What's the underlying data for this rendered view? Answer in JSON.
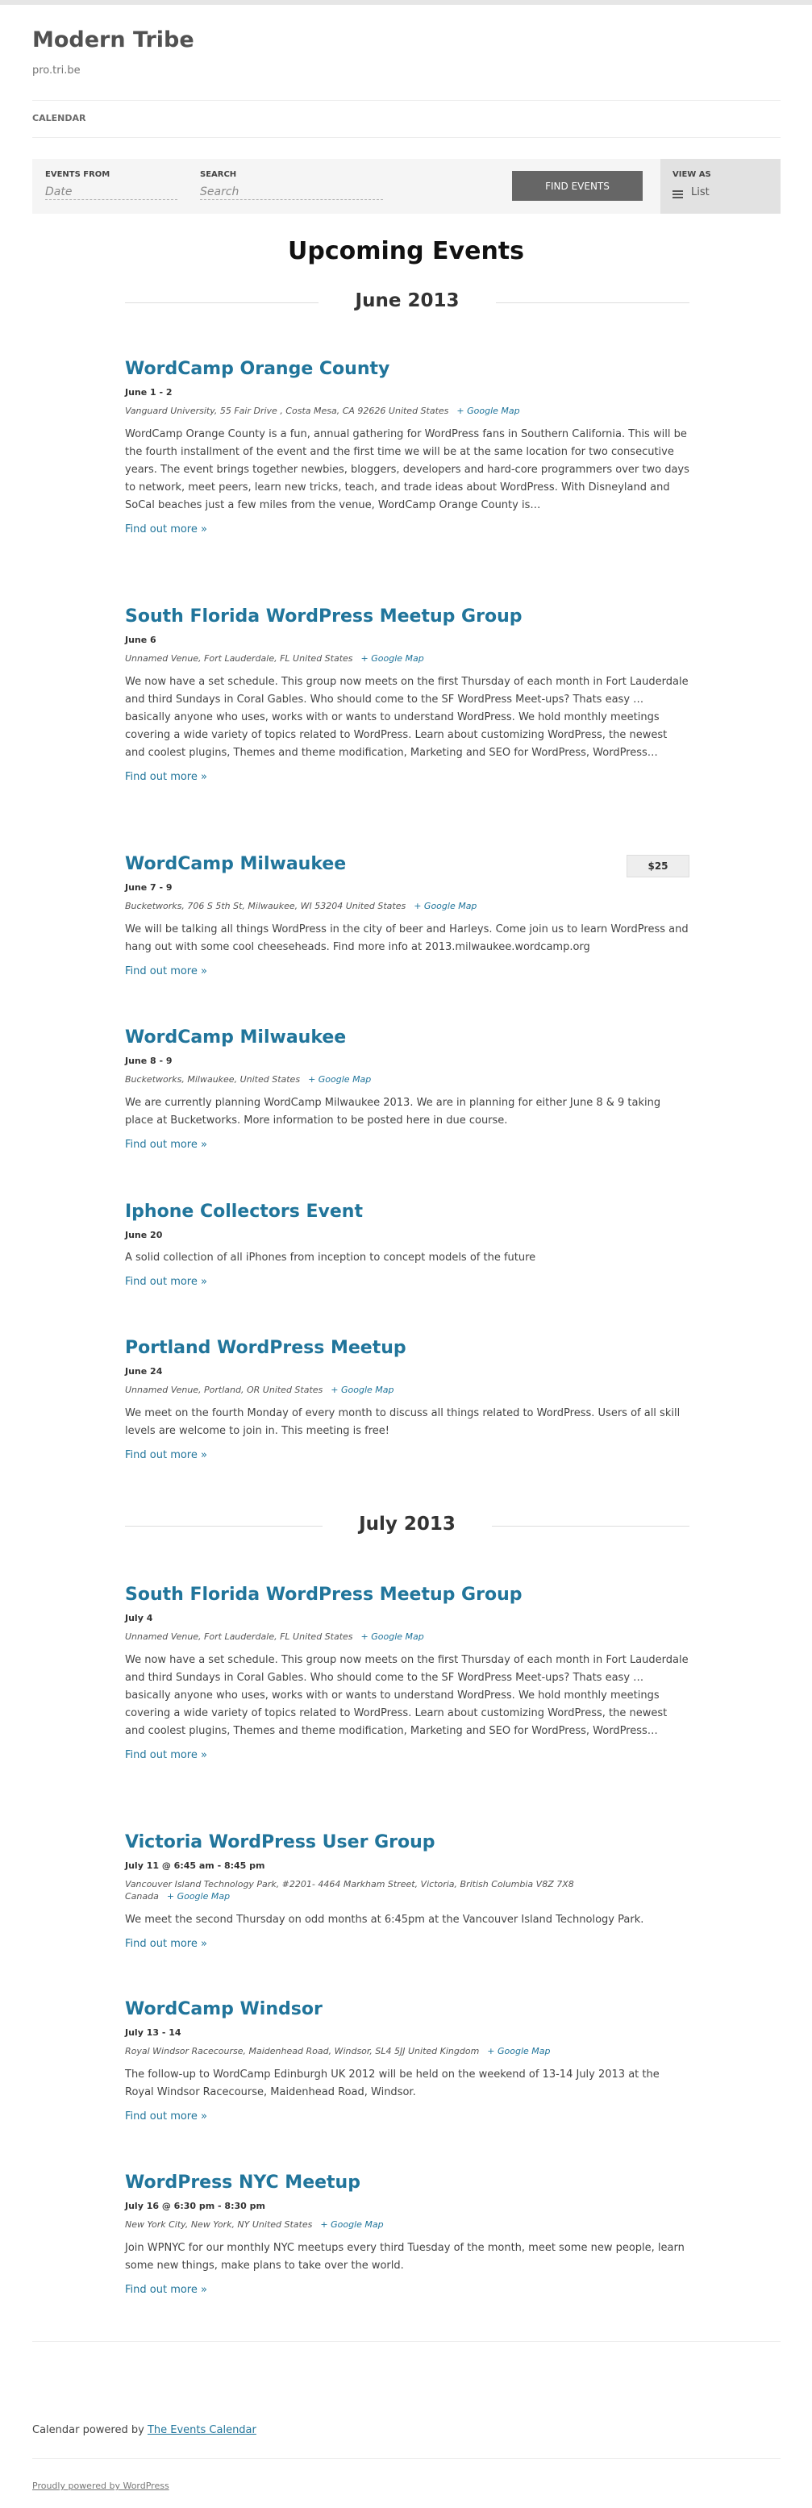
{
  "site": {
    "title": "Modern Tribe",
    "tagline": "pro.tri.be"
  },
  "nav": {
    "calendar": "CALENDAR"
  },
  "filter_bar": {
    "events_from_label": "EVENTS FROM",
    "date_placeholder": "Date",
    "search_label": "SEARCH",
    "search_placeholder": "Search",
    "find_button": "FIND EVENTS",
    "view_as_label": "VIEW AS",
    "view_as_value": "List"
  },
  "heading": "Upcoming Events",
  "months": [
    {
      "label": "June 2013"
    },
    {
      "label": "July 2013"
    }
  ],
  "events": [
    {
      "title": "WordCamp Orange County",
      "date": "June 1 - 2",
      "venue": "Vanguard University, 55 Fair Drive , Costa Mesa, CA 92626 United States",
      "gmap": "+ Google Map",
      "desc": "WordCamp Orange County is a fun, annual gathering for WordPress fans in Southern California. This will be the fourth installment of the event and the first time we will be at the same location for two consecutive years. The event brings together newbies, bloggers, developers and hard-core programmers over two days to network, meet peers, learn new tricks, teach, and trade ideas about WordPress. With Disneyland and SoCal beaches just a few miles from the venue, WordCamp Orange County is…",
      "more": "Find out more »"
    },
    {
      "title": "South Florida WordPress Meetup Group",
      "date": "June 6",
      "venue": "Unnamed Venue, Fort Lauderdale, FL United States",
      "gmap": "+ Google Map",
      "desc": "We now have a set schedule. This group now meets on the first Thursday of each month in Fort Lauderdale and third Sundays in Coral Gables. Who should come to the SF WordPress Meet-ups? Thats easy … basically anyone who uses, works with or wants to understand WordPress. We hold monthly meetings covering a wide variety of topics related to WordPress. Learn about customizing WordPress, the newest and coolest plugins, Themes and theme modification, Marketing and SEO for WordPress, WordPress…",
      "more": "Find out more »"
    },
    {
      "title": "WordCamp Milwaukee",
      "date": "June 7 - 9",
      "cost": "$25",
      "venue": "Bucketworks, 706 S 5th St, Milwaukee, WI 53204 United States",
      "gmap": "+ Google Map",
      "desc": "We will be talking all things WordPress in the city of beer and Harleys.  Come join us to learn WordPress and hang out with some cool cheeseheads.  Find more info at 2013.milwaukee.wordcamp.org",
      "more": "Find out more »"
    },
    {
      "title": "WordCamp Milwaukee",
      "date": "June 8 - 9",
      "venue": "Bucketworks, Milwaukee, United States",
      "gmap": "+ Google Map",
      "desc": "We are currently planning WordCamp Milwaukee 2013. We are in planning for either June 8 & 9 taking place at Bucketworks. More information to be posted here in due course.",
      "more": "Find out more »"
    },
    {
      "title": "Iphone Collectors Event",
      "date": "June 20",
      "desc": "A solid collection of all iPhones from inception to concept models of the future",
      "more": "Find out more »"
    },
    {
      "title": "Portland WordPress Meetup",
      "date": "June 24",
      "venue": "Unnamed Venue, Portland, OR United States",
      "gmap": "+ Google Map",
      "desc": "We meet on the fourth Monday of every month to discuss all things related to WordPress. Users of all skill levels are welcome to join in. This meeting is free!",
      "more": "Find out more »"
    },
    {
      "title": "South Florida WordPress Meetup Group",
      "date": "July 4",
      "venue": "Unnamed Venue, Fort Lauderdale, FL United States",
      "gmap": "+ Google Map",
      "desc": "We now have a set schedule. This group now meets on the first Thursday of each month in Fort Lauderdale and third Sundays in Coral Gables. Who should come to the SF WordPress Meet-ups? Thats easy … basically anyone who uses, works with or wants to understand WordPress. We hold monthly meetings covering a wide variety of topics related to WordPress. Learn about customizing WordPress, the newest and coolest plugins, Themes and theme modification, Marketing and SEO for WordPress, WordPress…",
      "more": "Find out more »"
    },
    {
      "title": "Victoria WordPress User Group",
      "date": "July 11 @ 6:45 am - 8:45 pm",
      "venue": "Vancouver Island Technology Park, #2201- 4464 Markham Street, Victoria, British Columbia V8Z 7X8 Canada",
      "gmap": "+ Google Map",
      "desc": "We meet the second Thursday on odd months at 6:45pm at the Vancouver Island Technology Park.",
      "more": "Find out more »"
    },
    {
      "title": "WordCamp Windsor",
      "date": "July 13 - 14",
      "venue": "Royal Windsor Racecourse, Maidenhead Road, Windsor, SL4 5JJ United Kingdom",
      "gmap": "+ Google Map",
      "desc": "The follow-up to WordCamp Edinburgh UK 2012 will be held on the weekend of 13-14 July 2013 at the Royal Windsor Racecourse, Maidenhead Road, Windsor.",
      "more": "Find out more »"
    },
    {
      "title": "WordPress NYC Meetup",
      "date": "July 16 @ 6:30 pm - 8:30 pm",
      "venue": "New York City, New York, NY United States",
      "gmap": "+ Google Map",
      "desc": "Join WPNYC for our monthly NYC meetups every third Tuesday of the month, meet some new people, learn some new things, make plans to take over the world.",
      "more": "Find out more »"
    }
  ],
  "footer": {
    "powered_prefix": "Calendar powered by",
    "powered_link": "The Events Calendar",
    "proudly": "Proudly powered by WordPress"
  },
  "colors": {
    "link": "#21759b",
    "button": "#666666",
    "bar_bg": "#f5f5f5"
  },
  "icons": {
    "view_as": "list-icon"
  }
}
